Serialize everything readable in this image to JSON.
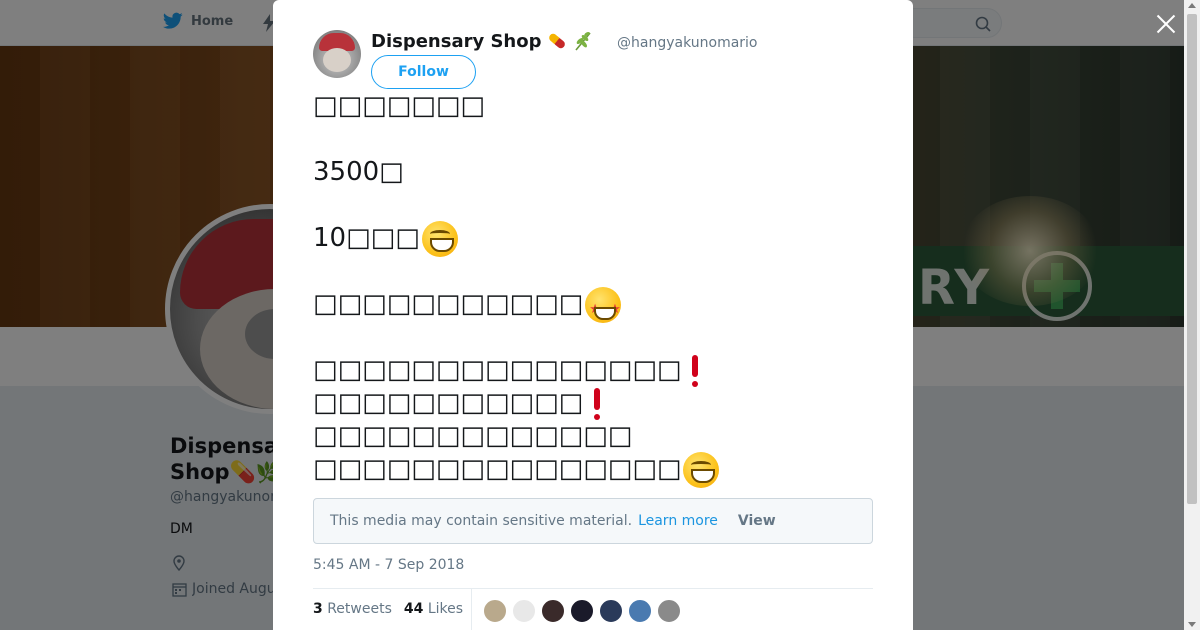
{
  "nav": {
    "home_label": "Home"
  },
  "profile": {
    "name": "Dispensary Shop💊🌿",
    "handle": "@hangyakunomario",
    "bio": "DM",
    "joined": "Joined August"
  },
  "banner": {
    "sign_text": "RY"
  },
  "tweet": {
    "name": "Dispensary Shop",
    "handle": "@hangyakunomario",
    "follow_label": "Follow",
    "lines": {
      "l1": "□□□□□□□",
      "l2": "3500□",
      "l3": "10□□□",
      "l4": "□□□□□□□□□□□",
      "l5": "□□□□□□□□□□□□□□□",
      "l6": "□□□□□□□□□□□",
      "l7": "□□□□□□□□□□□□□",
      "l8": "□□□□□□□□□□□□□□□"
    },
    "sensitive_text": "This media may contain sensitive material.",
    "learn_more": "Learn more",
    "view": "View",
    "timestamp": "5:45 AM - 7 Sep 2018",
    "retweets_count": "3",
    "retweets_label": "Retweets",
    "likes_count": "44",
    "likes_label": "Likes"
  },
  "likers": [
    "#b9a98c",
    "#e8e8e8",
    "#3a2a2a",
    "#1a1a2a",
    "#2a3a5a",
    "#4a7ab0",
    "#8a8a8a"
  ],
  "icons": [
    "twitter-bird-icon",
    "search-icon",
    "close-icon",
    "pill-icon",
    "herb-icon",
    "location-icon",
    "calendar-icon",
    "grinning-emoji-icon",
    "star-struck-emoji-icon",
    "exclamation-icon"
  ],
  "colors": {
    "brand": "#1da1f2",
    "link": "#1b95e0",
    "muted": "#657786",
    "text": "#14171a"
  }
}
